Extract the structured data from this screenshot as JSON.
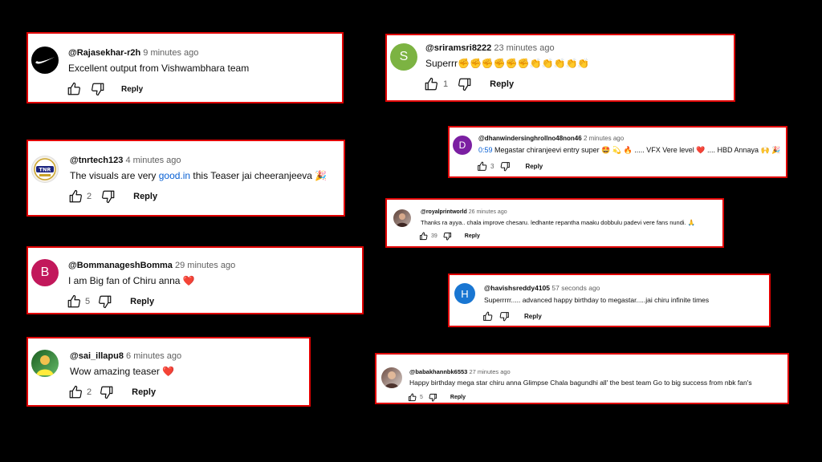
{
  "comments": [
    {
      "author": "@Rajasekhar-r2h",
      "time": "9 minutes ago",
      "text": "Excellent output from Vishwambhara team",
      "likes": "",
      "reply": "Reply",
      "avatar": {
        "letter": "",
        "color": "#000000",
        "icon": "nike-swoosh-icon"
      }
    },
    {
      "author": "@tnrtech123",
      "time": "4 minutes ago",
      "text_pre": "The visuals are very ",
      "link": "good.in",
      "text_post": " this Teaser jai cheeranjeeva 🎉",
      "likes": "2",
      "reply": "Reply",
      "avatar": {
        "letter": "TNR",
        "color": "#f5f0e6",
        "icon": "tnr-logo-icon"
      }
    },
    {
      "author": "@BommanageshBomma",
      "time": "29 minutes ago",
      "text": "I am  Big fan of Chiru anna ❤️",
      "likes": "5",
      "reply": "Reply",
      "avatar": {
        "letter": "B",
        "color": "#c2185b",
        "icon": "letter-avatar-icon"
      }
    },
    {
      "author": "@sai_illapu8",
      "time": "6 minutes ago",
      "text": "Wow amazing teaser ❤️",
      "likes": "2",
      "reply": "Reply",
      "avatar": {
        "letter": "",
        "color": "#2e7d32",
        "icon": "profile-photo-icon"
      }
    },
    {
      "author": "@sriramsri8222",
      "time": "23 minutes ago",
      "text": "Superrr✊✊✊✊✊✊👏👏👏👏👏",
      "likes": "1",
      "reply": "Reply",
      "avatar": {
        "letter": "S",
        "color": "#7cb342",
        "icon": "letter-avatar-icon"
      }
    },
    {
      "author": "@dhanwindersinghrollno48non46",
      "time": "2 minutes ago",
      "timestamp_link": "0:59",
      "text": " Megastar chiranjeevi entry super 🤩 💫 🔥 ..... VFX Vere level ❤️ .... HBD Annaya 🙌 🎉",
      "likes": "3",
      "reply": "Reply",
      "avatar": {
        "letter": "D",
        "color": "#7b1fa2",
        "icon": "letter-avatar-icon"
      }
    },
    {
      "author": "@royalprintworld",
      "time": "26 minutes ago",
      "text": "Thanks ra ayya.. chala improve chesaru. ledhante repantha maaku dobbulu padevi vere fans nundi. 🙏",
      "likes": "39",
      "reply": "Reply",
      "avatar": {
        "letter": "",
        "color": "#8d6e63",
        "icon": "profile-photo-icon"
      }
    },
    {
      "author": "@havishsreddy4105",
      "time": "57 seconds ago",
      "text": "Superrrrr..... advanced happy birthday to megastar.....jai chiru infinite times",
      "likes": "",
      "reply": "Reply",
      "avatar": {
        "letter": "H",
        "color": "#1976d2",
        "icon": "letter-avatar-icon"
      }
    },
    {
      "author": "@babakhannbk6553",
      "time": "27 minutes ago",
      "text": "Happy birthday mega star chiru anna  Glimpse Chala  bagundhi   all' the best team Go to big success  from nbk fan's",
      "likes": "5",
      "reply": "Reply",
      "avatar": {
        "letter": "",
        "color": "#a1887f",
        "icon": "profile-photo-icon"
      }
    }
  ]
}
